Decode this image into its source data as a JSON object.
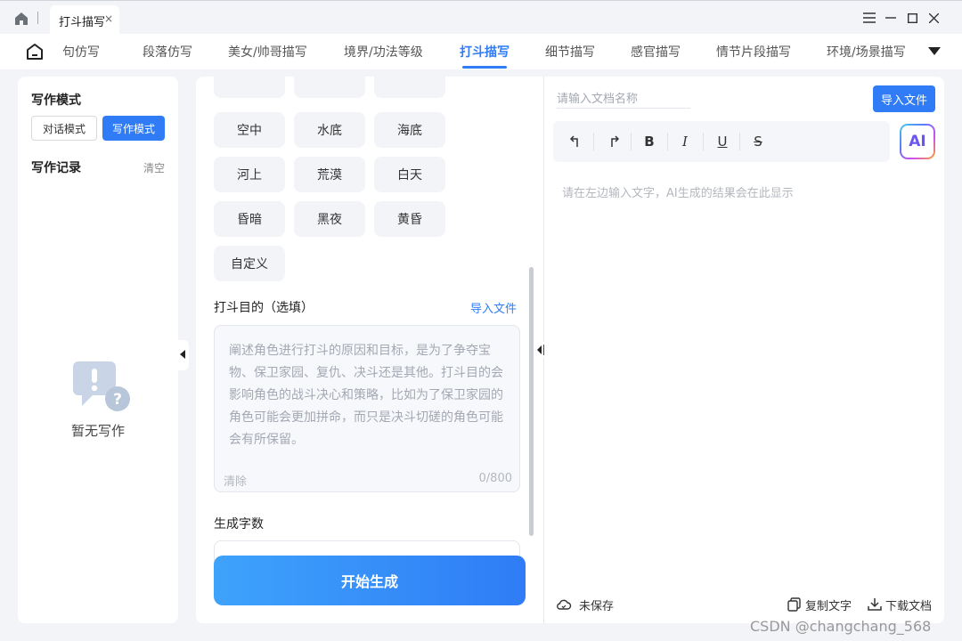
{
  "window": {
    "tab_title": "打斗描写",
    "tab_close": "×"
  },
  "nav": {
    "items": [
      "句仿写",
      "段落仿写",
      "美女/帅哥描写",
      "境界/功法等级",
      "打斗描写",
      "细节描写",
      "感官描写",
      "情节片段描写",
      "环境/场景描写"
    ],
    "active": "打斗描写"
  },
  "sidebar": {
    "mode_title": "写作模式",
    "modes": [
      "对话模式",
      "写作模式"
    ],
    "active_mode": "写作模式",
    "records_title": "写作记录",
    "clear_label": "清空",
    "empty_text": "暂无写作"
  },
  "scene_chips": [
    "空中",
    "水底",
    "海底",
    "河上",
    "荒漠",
    "白天",
    "昏暗",
    "黑夜",
    "黄昏",
    "自定义"
  ],
  "purpose": {
    "label": "打斗目的（选填）",
    "import_label": "导入文件",
    "placeholder": "阐述角色进行打斗的原因和目标，是为了争夺宝物、保卫家园、复仇、决斗还是其他。打斗目的会影响角色的战斗决心和策略，比如为了保卫家园的角色可能会更加拼命，而只是决斗切磋的角色可能会有所保留。",
    "clear_label": "清除",
    "counter": "0/800"
  },
  "word_count": {
    "label": "生成字数"
  },
  "generate_button": "开始生成",
  "editor": {
    "doc_name_placeholder": "请输入文档名称",
    "import_label": "导入文件",
    "toolbar": {
      "bold": "B",
      "italic": "I",
      "underline": "U",
      "strike": "S"
    },
    "ai_label": "AI",
    "output_placeholder": "请在左边输入文字，AI生成的结果会在此显示",
    "save_status": "未保存",
    "copy_label": "复制文字",
    "download_label": "下载文档"
  },
  "watermark": "CSDN @changchang_568"
}
